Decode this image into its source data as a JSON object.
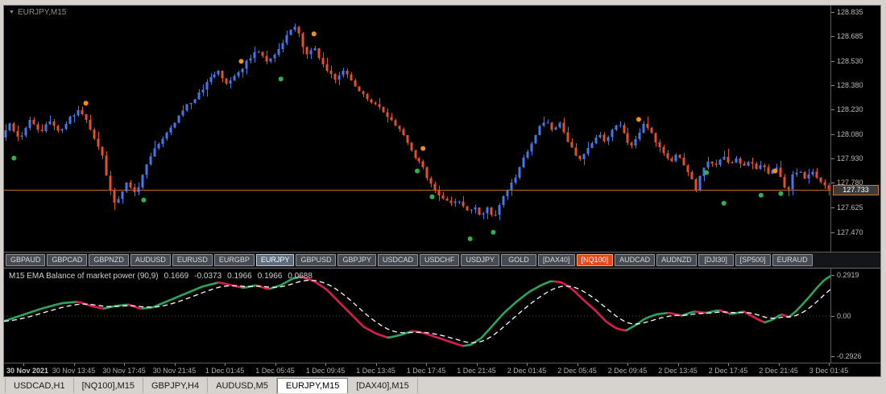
{
  "chart_window": {
    "collapse_icon": "▼",
    "title": "EURJPY,M15"
  },
  "symbol_buttons": [
    {
      "label": "GBPAUD",
      "state": "normal"
    },
    {
      "label": "GBPCAD",
      "state": "normal"
    },
    {
      "label": "GBPNZD",
      "state": "normal"
    },
    {
      "label": "AUDUSD",
      "state": "normal"
    },
    {
      "label": "EURUSD",
      "state": "normal"
    },
    {
      "label": "EURGBP",
      "state": "normal"
    },
    {
      "label": "EURJPY",
      "state": "active"
    },
    {
      "label": "GBPUSD",
      "state": "normal"
    },
    {
      "label": "GBPJPY",
      "state": "normal"
    },
    {
      "label": "USDCAD",
      "state": "normal"
    },
    {
      "label": "USDCHF",
      "state": "normal"
    },
    {
      "label": "USDJPY",
      "state": "normal"
    },
    {
      "label": "GOLD",
      "state": "normal"
    },
    {
      "label": "[DAX40]",
      "state": "normal"
    },
    {
      "label": "[NQ100]",
      "state": "alert"
    },
    {
      "label": "AUDCAD",
      "state": "normal"
    },
    {
      "label": "AUDNZD",
      "state": "normal"
    },
    {
      "label": "[DJI30]",
      "state": "normal"
    },
    {
      "label": "[SP500]",
      "state": "normal"
    },
    {
      "label": "EURAUD",
      "state": "normal"
    }
  ],
  "indicator_panel": {
    "name": "M15 EMA Balance of market power (90,9)",
    "values": [
      "0.1669",
      "-0.0373",
      "0.1966",
      "0.1966",
      "0.0688"
    ]
  },
  "bottom_tabs": [
    {
      "label": "USDCAD,H1",
      "active": false
    },
    {
      "label": "[NQ100],M15",
      "active": false
    },
    {
      "label": "GBPJPY,H4",
      "active": false
    },
    {
      "label": "AUDUSD,M5",
      "active": false
    },
    {
      "label": "EURJPY,M15",
      "active": true
    },
    {
      "label": "[DAX40],M15",
      "active": false
    }
  ],
  "chart_data": [
    {
      "type": "candlestick",
      "symbol": "EURJPY",
      "timeframe": "M15",
      "ylim": [
        127.35,
        128.875
      ],
      "y_tick_labels": [
        "128.835",
        "128.685",
        "128.530",
        "128.380",
        "128.230",
        "128.080",
        "127.930",
        "127.780",
        "127.625",
        "127.470"
      ],
      "x_tick_labels": [
        "30 Nov 2021",
        "30 Nov 13:45",
        "30 Nov 17:45",
        "30 Nov 21:45",
        "1 Dec 01:45",
        "1 Dec 05:45",
        "1 Dec 09:45",
        "1 Dec 13:45",
        "1 Dec 17:45",
        "1 Dec 21:45",
        "2 Dec 01:45",
        "2 Dec 05:45",
        "2 Dec 09:45",
        "2 Dec 13:45",
        "2 Dec 17:45",
        "2 Dec 21:45",
        "3 Dec 01:45"
      ],
      "current_price": "127.733",
      "price_line": {
        "value": 127.733,
        "color": "#c9762b"
      },
      "candle_count": 206,
      "seed": 7,
      "colors": {
        "up": "#4478e8",
        "down": "#e0502c",
        "signal_green": "#30b050",
        "signal_orange": "#f09020"
      },
      "price_path": [
        [
          0.0,
          128.06
        ],
        [
          0.01,
          128.14
        ],
        [
          0.022,
          128.05
        ],
        [
          0.034,
          128.16
        ],
        [
          0.046,
          128.09
        ],
        [
          0.058,
          128.16
        ],
        [
          0.07,
          128.1
        ],
        [
          0.082,
          128.18
        ],
        [
          0.094,
          128.23
        ],
        [
          0.104,
          128.15
        ],
        [
          0.112,
          128.04
        ],
        [
          0.12,
          127.97
        ],
        [
          0.128,
          127.78
        ],
        [
          0.136,
          127.65
        ],
        [
          0.144,
          127.71
        ],
        [
          0.152,
          127.79
        ],
        [
          0.158,
          127.7
        ],
        [
          0.166,
          127.75
        ],
        [
          0.176,
          127.92
        ],
        [
          0.19,
          128.03
        ],
        [
          0.205,
          128.12
        ],
        [
          0.22,
          128.24
        ],
        [
          0.235,
          128.31
        ],
        [
          0.25,
          128.41
        ],
        [
          0.262,
          128.47
        ],
        [
          0.272,
          128.39
        ],
        [
          0.285,
          128.45
        ],
        [
          0.298,
          128.54
        ],
        [
          0.31,
          128.6
        ],
        [
          0.32,
          128.52
        ],
        [
          0.33,
          128.57
        ],
        [
          0.342,
          128.66
        ],
        [
          0.352,
          128.76
        ],
        [
          0.36,
          128.7
        ],
        [
          0.368,
          128.56
        ],
        [
          0.378,
          128.62
        ],
        [
          0.39,
          128.49
        ],
        [
          0.402,
          128.42
        ],
        [
          0.414,
          128.48
        ],
        [
          0.428,
          128.36
        ],
        [
          0.442,
          128.3
        ],
        [
          0.456,
          128.24
        ],
        [
          0.47,
          128.16
        ],
        [
          0.484,
          128.1
        ],
        [
          0.492,
          128.0
        ],
        [
          0.5,
          127.94
        ],
        [
          0.51,
          127.86
        ],
        [
          0.52,
          127.76
        ],
        [
          0.53,
          127.7
        ],
        [
          0.54,
          127.65
        ],
        [
          0.552,
          127.67
        ],
        [
          0.562,
          127.6
        ],
        [
          0.572,
          127.63
        ],
        [
          0.58,
          127.57
        ],
        [
          0.588,
          127.62
        ],
        [
          0.596,
          127.56
        ],
        [
          0.604,
          127.66
        ],
        [
          0.612,
          127.74
        ],
        [
          0.62,
          127.8
        ],
        [
          0.63,
          127.92
        ],
        [
          0.64,
          128.02
        ],
        [
          0.65,
          128.12
        ],
        [
          0.658,
          128.18
        ],
        [
          0.666,
          128.1
        ],
        [
          0.674,
          128.16
        ],
        [
          0.682,
          128.06
        ],
        [
          0.69,
          127.98
        ],
        [
          0.698,
          127.91
        ],
        [
          0.706,
          127.97
        ],
        [
          0.714,
          128.03
        ],
        [
          0.722,
          128.08
        ],
        [
          0.73,
          128.03
        ],
        [
          0.738,
          128.1
        ],
        [
          0.746,
          128.14
        ],
        [
          0.754,
          128.06
        ],
        [
          0.762,
          128.0
        ],
        [
          0.77,
          128.08
        ],
        [
          0.778,
          128.15
        ],
        [
          0.786,
          128.09
        ],
        [
          0.794,
          128.01
        ],
        [
          0.802,
          127.95
        ],
        [
          0.81,
          127.9
        ],
        [
          0.818,
          127.96
        ],
        [
          0.826,
          127.88
        ],
        [
          0.834,
          127.8
        ],
        [
          0.84,
          127.74
        ],
        [
          0.848,
          127.86
        ],
        [
          0.856,
          127.92
        ],
        [
          0.864,
          127.88
        ],
        [
          0.872,
          127.94
        ],
        [
          0.88,
          127.89
        ],
        [
          0.888,
          127.93
        ],
        [
          0.896,
          127.87
        ],
        [
          0.904,
          127.92
        ],
        [
          0.912,
          127.85
        ],
        [
          0.92,
          127.9
        ],
        [
          0.928,
          127.83
        ],
        [
          0.936,
          127.88
        ],
        [
          0.944,
          127.78
        ],
        [
          0.95,
          127.7
        ],
        [
          0.956,
          127.82
        ],
        [
          0.964,
          127.86
        ],
        [
          0.972,
          127.8
        ],
        [
          0.98,
          127.84
        ],
        [
          0.99,
          127.78
        ],
        [
          1.0,
          127.73
        ]
      ],
      "signals": [
        {
          "x": 0.012,
          "price": 127.93,
          "color": "green"
        },
        {
          "x": 0.099,
          "price": 128.27,
          "color": "orange"
        },
        {
          "x": 0.169,
          "price": 127.67,
          "color": "green"
        },
        {
          "x": 0.287,
          "price": 128.53,
          "color": "orange"
        },
        {
          "x": 0.335,
          "price": 128.42,
          "color": "green"
        },
        {
          "x": 0.375,
          "price": 128.7,
          "color": "orange"
        },
        {
          "x": 0.5,
          "price": 127.85,
          "color": "green"
        },
        {
          "x": 0.507,
          "price": 127.99,
          "color": "orange"
        },
        {
          "x": 0.518,
          "price": 127.69,
          "color": "green"
        },
        {
          "x": 0.564,
          "price": 127.43,
          "color": "green"
        },
        {
          "x": 0.592,
          "price": 127.47,
          "color": "green"
        },
        {
          "x": 0.768,
          "price": 128.17,
          "color": "orange"
        },
        {
          "x": 0.85,
          "price": 127.84,
          "color": "green"
        },
        {
          "x": 0.871,
          "price": 127.65,
          "color": "green"
        },
        {
          "x": 0.916,
          "price": 127.7,
          "color": "green"
        },
        {
          "x": 0.933,
          "price": 127.85,
          "color": "orange"
        },
        {
          "x": 0.94,
          "price": 127.71,
          "color": "green"
        }
      ]
    },
    {
      "type": "line",
      "title": "EMA Balance of market power (90,9)",
      "ylim": [
        -0.34,
        0.34
      ],
      "y_tick_labels": [
        "0.2919",
        "0.00",
        "-0.2926"
      ],
      "y_tick_values": [
        0.2919,
        0.0,
        -0.2926
      ],
      "colors": {
        "rising": "#2aa45e",
        "falling": "#d81e4a",
        "signal": "#ffffff",
        "zero_line": "#4a4a4a"
      },
      "signal_ema_alpha": 0.18,
      "points": [
        [
          0.0,
          -0.04
        ],
        [
          0.02,
          0.0
        ],
        [
          0.045,
          0.05
        ],
        [
          0.07,
          0.09
        ],
        [
          0.09,
          0.1
        ],
        [
          0.105,
          0.07
        ],
        [
          0.12,
          0.05
        ],
        [
          0.135,
          0.07
        ],
        [
          0.15,
          0.08
        ],
        [
          0.165,
          0.05
        ],
        [
          0.18,
          0.06
        ],
        [
          0.2,
          0.11
        ],
        [
          0.22,
          0.16
        ],
        [
          0.24,
          0.21
        ],
        [
          0.26,
          0.24
        ],
        [
          0.275,
          0.22
        ],
        [
          0.29,
          0.2
        ],
        [
          0.305,
          0.22
        ],
        [
          0.32,
          0.19
        ],
        [
          0.335,
          0.22
        ],
        [
          0.35,
          0.27
        ],
        [
          0.36,
          0.28
        ],
        [
          0.375,
          0.25
        ],
        [
          0.39,
          0.19
        ],
        [
          0.405,
          0.1
        ],
        [
          0.42,
          0.01
        ],
        [
          0.435,
          -0.08
        ],
        [
          0.45,
          -0.13
        ],
        [
          0.465,
          -0.16
        ],
        [
          0.48,
          -0.14
        ],
        [
          0.495,
          -0.11
        ],
        [
          0.51,
          -0.13
        ],
        [
          0.525,
          -0.16
        ],
        [
          0.54,
          -0.19
        ],
        [
          0.555,
          -0.22
        ],
        [
          0.565,
          -0.21
        ],
        [
          0.578,
          -0.16
        ],
        [
          0.59,
          -0.08
        ],
        [
          0.605,
          0.02
        ],
        [
          0.62,
          0.1
        ],
        [
          0.635,
          0.17
        ],
        [
          0.65,
          0.22
        ],
        [
          0.662,
          0.25
        ],
        [
          0.675,
          0.24
        ],
        [
          0.688,
          0.19
        ],
        [
          0.7,
          0.12
        ],
        [
          0.715,
          0.04
        ],
        [
          0.728,
          -0.04
        ],
        [
          0.74,
          -0.09
        ],
        [
          0.752,
          -0.11
        ],
        [
          0.764,
          -0.07
        ],
        [
          0.776,
          -0.02
        ],
        [
          0.79,
          0.01
        ],
        [
          0.805,
          0.02
        ],
        [
          0.82,
          0.0
        ],
        [
          0.835,
          0.03
        ],
        [
          0.85,
          0.02
        ],
        [
          0.865,
          0.04
        ],
        [
          0.88,
          0.01
        ],
        [
          0.895,
          0.03
        ],
        [
          0.91,
          -0.02
        ],
        [
          0.92,
          -0.05
        ],
        [
          0.93,
          -0.03
        ],
        [
          0.94,
          0.01
        ],
        [
          0.95,
          -0.01
        ],
        [
          0.958,
          0.03
        ],
        [
          0.966,
          0.08
        ],
        [
          0.975,
          0.14
        ],
        [
          0.985,
          0.21
        ],
        [
          0.993,
          0.26
        ],
        [
          1.0,
          0.285
        ]
      ]
    }
  ]
}
